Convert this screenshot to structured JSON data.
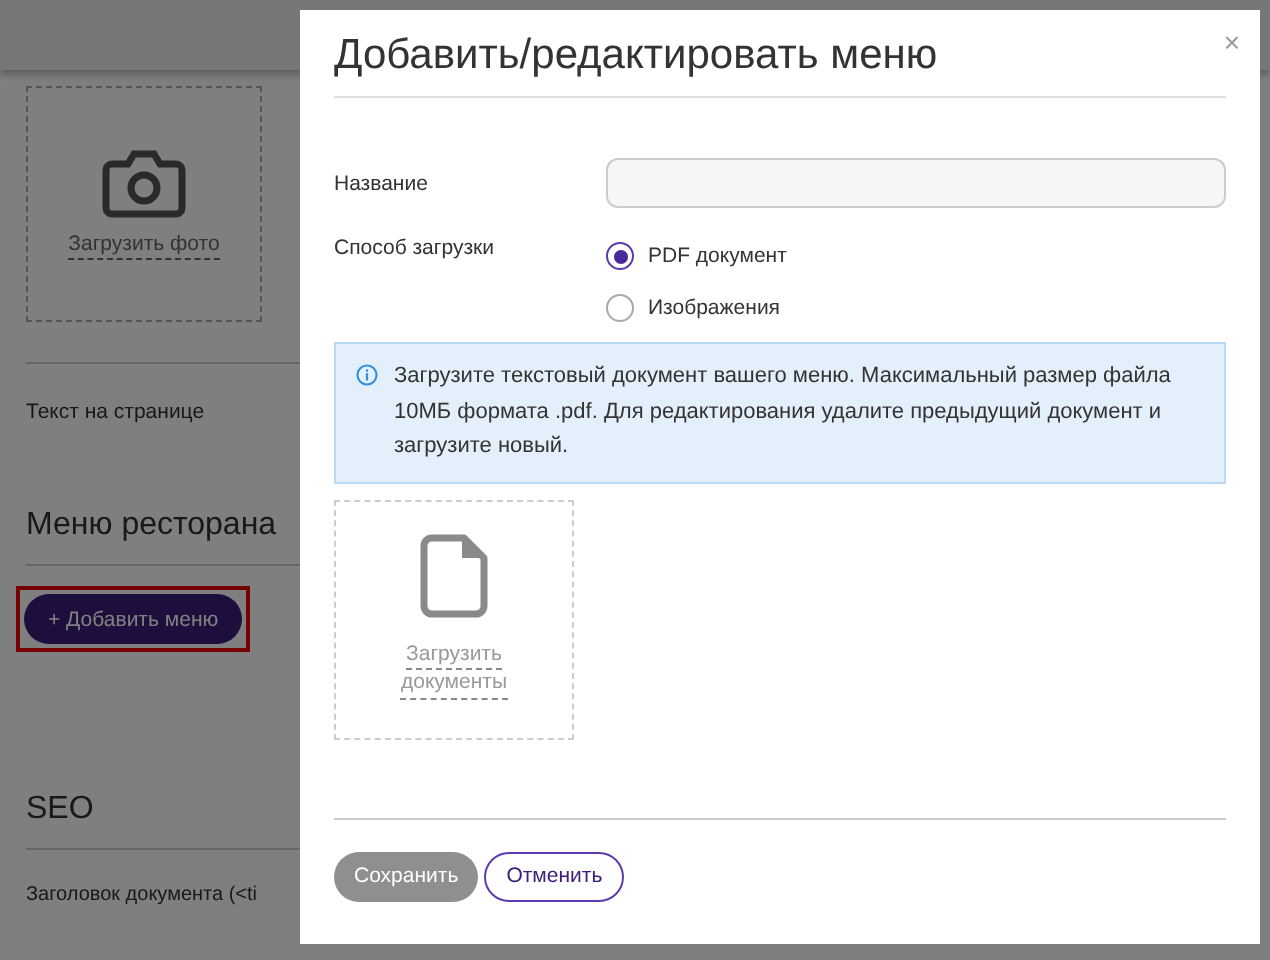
{
  "page": {
    "photo_upload": "Загрузить фото",
    "text_label": "Текст на странице",
    "menu_heading": "Меню ресторана",
    "add_menu_button": {
      "icon": "+",
      "label": "Добавить меню",
      "highlighted": true
    },
    "seo_heading": "SEO",
    "doc_title_label": "Заголовок документа (<ti"
  },
  "dialog": {
    "title": "Добавить/редактировать меню",
    "close": "×",
    "name_label": "Название",
    "upload_method_label": "Способ загрузки",
    "options": [
      {
        "label": "PDF документ",
        "selected": true
      },
      {
        "label": "Изображения",
        "selected": false
      }
    ],
    "info": "Загрузите текстовый документ вашего меню. Максимальный размер файла 10МБ формата .pdf. Для редактирования удалите предыдущий документ и загрузите новый.",
    "upload_lines": [
      "Загрузить",
      "документы"
    ],
    "buttons": [
      {
        "label": "Сохранить",
        "disabled": true
      },
      {
        "label": "Отменить",
        "disabled": false
      }
    ]
  }
}
